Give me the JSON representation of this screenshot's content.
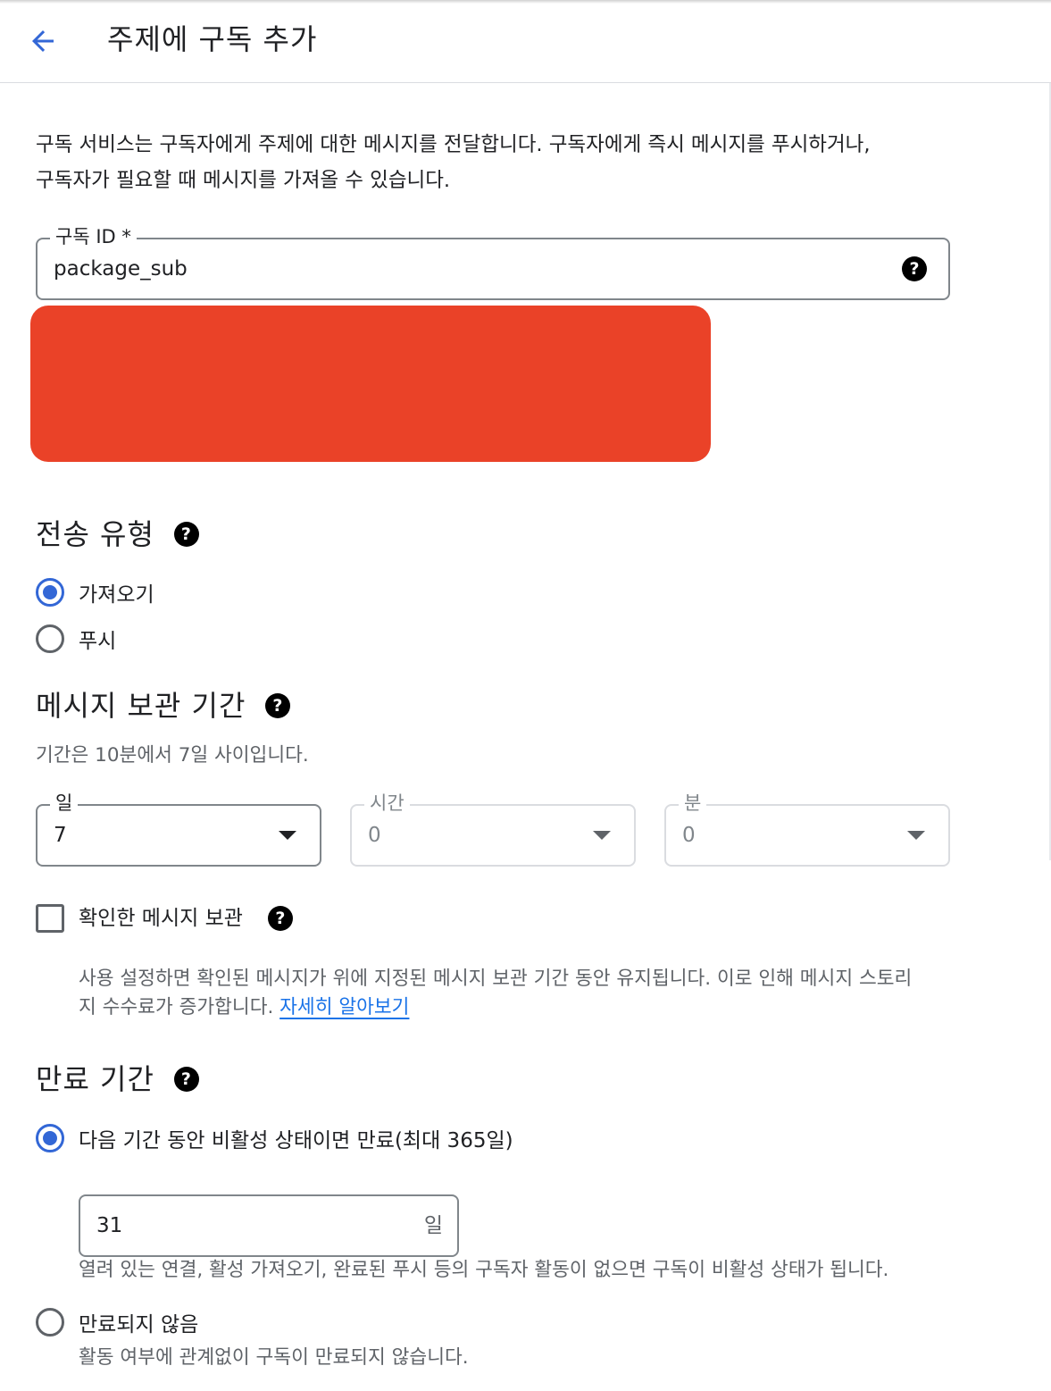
{
  "header": {
    "title": "주제에 구독 추가"
  },
  "intro": {
    "line1": "구독 서비스는 구독자에게 주제에 대한 메시지를 전달합니다. 구독자에게 즉시 메시지를 푸시하거나,",
    "line2": "구독자가 필요할 때 메시지를 가져올 수 있습니다."
  },
  "subscription_id": {
    "label": "구독 ID *",
    "value": "package_sub"
  },
  "delivery": {
    "title": "전송 유형",
    "options": [
      {
        "label": "가져오기",
        "checked": true
      },
      {
        "label": "푸시",
        "checked": false
      }
    ]
  },
  "retention": {
    "title": "메시지 보관 기간",
    "hint": "기간은 10분에서 7일 사이입니다.",
    "days": {
      "label": "일",
      "value": "7"
    },
    "hours": {
      "label": "시간",
      "value": "0"
    },
    "minutes": {
      "label": "분",
      "value": "0"
    },
    "retain_acked": {
      "label": "확인한 메시지 보관",
      "checked": false,
      "desc_line1": "사용 설정하면 확인된 메시지가 위에 지정된 메시지 보관 기간 동안 유지됩니다. 이로 인해 메시지 스토리",
      "desc_line2": "지 수수료가 증가합니다. ",
      "learn_more": "자세히 알아보기"
    }
  },
  "expiration": {
    "title": "만료 기간",
    "option_inactive": {
      "label": "다음 기간 동안 비활성 상태이면 만료(최대 365일)",
      "checked": true,
      "value": "31",
      "unit": "일",
      "hint": "열려 있는 연결, 활성 가져오기, 완료된 푸시 등의 구독자 활동이 없으면 구독이 비활성 상태가 됩니다."
    },
    "option_never": {
      "label": "만료되지 않음",
      "checked": false,
      "hint": "활동 여부에 관계없이 구독이 만료되지 않습니다."
    }
  },
  "icons": {
    "back": "arrow-back-icon",
    "help": "help-icon",
    "dropdown": "dropdown-caret-icon"
  },
  "colors": {
    "accent": "#3367d6",
    "link": "#1a73e8",
    "redaction": "#ea4228"
  }
}
